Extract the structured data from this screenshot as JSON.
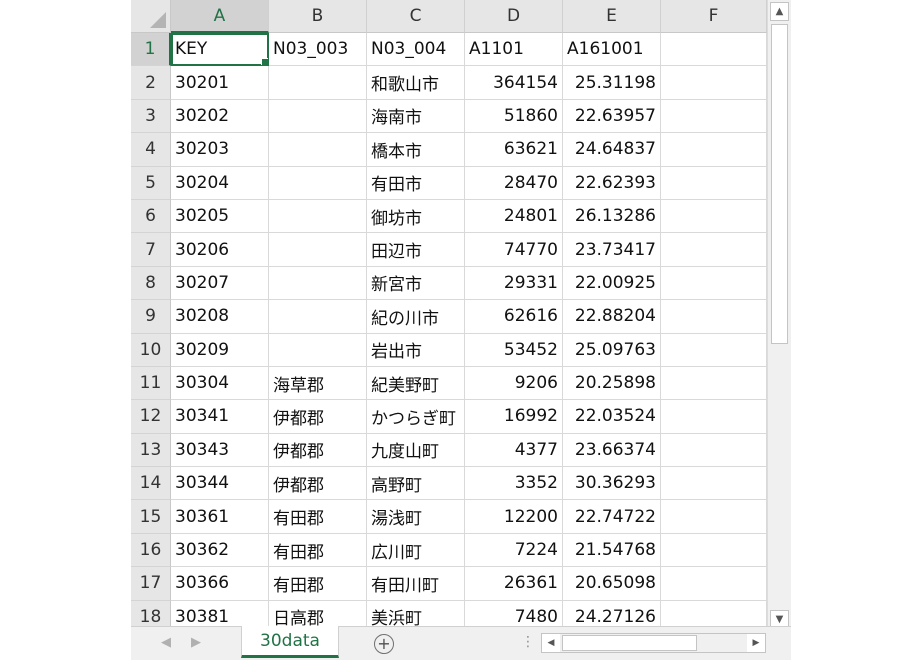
{
  "columns": [
    "A",
    "B",
    "C",
    "D",
    "E",
    "F"
  ],
  "rows": [
    {
      "n": "1",
      "a": "KEY",
      "b": "N03_003",
      "c": "N03_004",
      "d": "A1101",
      "e": "A161001"
    },
    {
      "n": "2",
      "a": "30201",
      "b": "",
      "c": "和歌山市",
      "d": "364154",
      "e": "25.31198"
    },
    {
      "n": "3",
      "a": "30202",
      "b": "",
      "c": "海南市",
      "d": "51860",
      "e": "22.63957"
    },
    {
      "n": "4",
      "a": "30203",
      "b": "",
      "c": "橋本市",
      "d": "63621",
      "e": "24.64837"
    },
    {
      "n": "5",
      "a": "30204",
      "b": "",
      "c": "有田市",
      "d": "28470",
      "e": "22.62393"
    },
    {
      "n": "6",
      "a": "30205",
      "b": "",
      "c": "御坊市",
      "d": "24801",
      "e": "26.13286"
    },
    {
      "n": "7",
      "a": "30206",
      "b": "",
      "c": "田辺市",
      "d": "74770",
      "e": "23.73417"
    },
    {
      "n": "8",
      "a": "30207",
      "b": "",
      "c": "新宮市",
      "d": "29331",
      "e": "22.00925"
    },
    {
      "n": "9",
      "a": "30208",
      "b": "",
      "c": "紀の川市",
      "d": "62616",
      "e": "22.88204"
    },
    {
      "n": "10",
      "a": "30209",
      "b": "",
      "c": "岩出市",
      "d": "53452",
      "e": "25.09763"
    },
    {
      "n": "11",
      "a": "30304",
      "b": "海草郡",
      "c": "紀美野町",
      "d": "9206",
      "e": "20.25898"
    },
    {
      "n": "12",
      "a": "30341",
      "b": "伊都郡",
      "c": "かつらぎ町",
      "d": "16992",
      "e": "22.03524"
    },
    {
      "n": "13",
      "a": "30343",
      "b": "伊都郡",
      "c": "九度山町",
      "d": "4377",
      "e": "23.66374"
    },
    {
      "n": "14",
      "a": "30344",
      "b": "伊都郡",
      "c": "高野町",
      "d": "3352",
      "e": "30.36293"
    },
    {
      "n": "15",
      "a": "30361",
      "b": "有田郡",
      "c": "湯浅町",
      "d": "12200",
      "e": "22.74722"
    },
    {
      "n": "16",
      "a": "30362",
      "b": "有田郡",
      "c": "広川町",
      "d": "7224",
      "e": "21.54768"
    },
    {
      "n": "17",
      "a": "30366",
      "b": "有田郡",
      "c": "有田川町",
      "d": "26361",
      "e": "20.65098"
    },
    {
      "n": "18",
      "a": "30381",
      "b": "日高郡",
      "c": "美浜町",
      "d": "7480",
      "e": "24.27126"
    }
  ],
  "sheet_tab": "30data",
  "add_sheet_symbol": "+",
  "colors": {
    "accent": "#217346",
    "header_bg": "#e6e6e6"
  },
  "icons": {
    "corner": "select-all-triangle-icon",
    "scroll_up": "scroll-up-arrow-icon",
    "scroll_down": "scroll-down-arrow-icon",
    "add_sheet": "add-sheet-plus-icon"
  }
}
